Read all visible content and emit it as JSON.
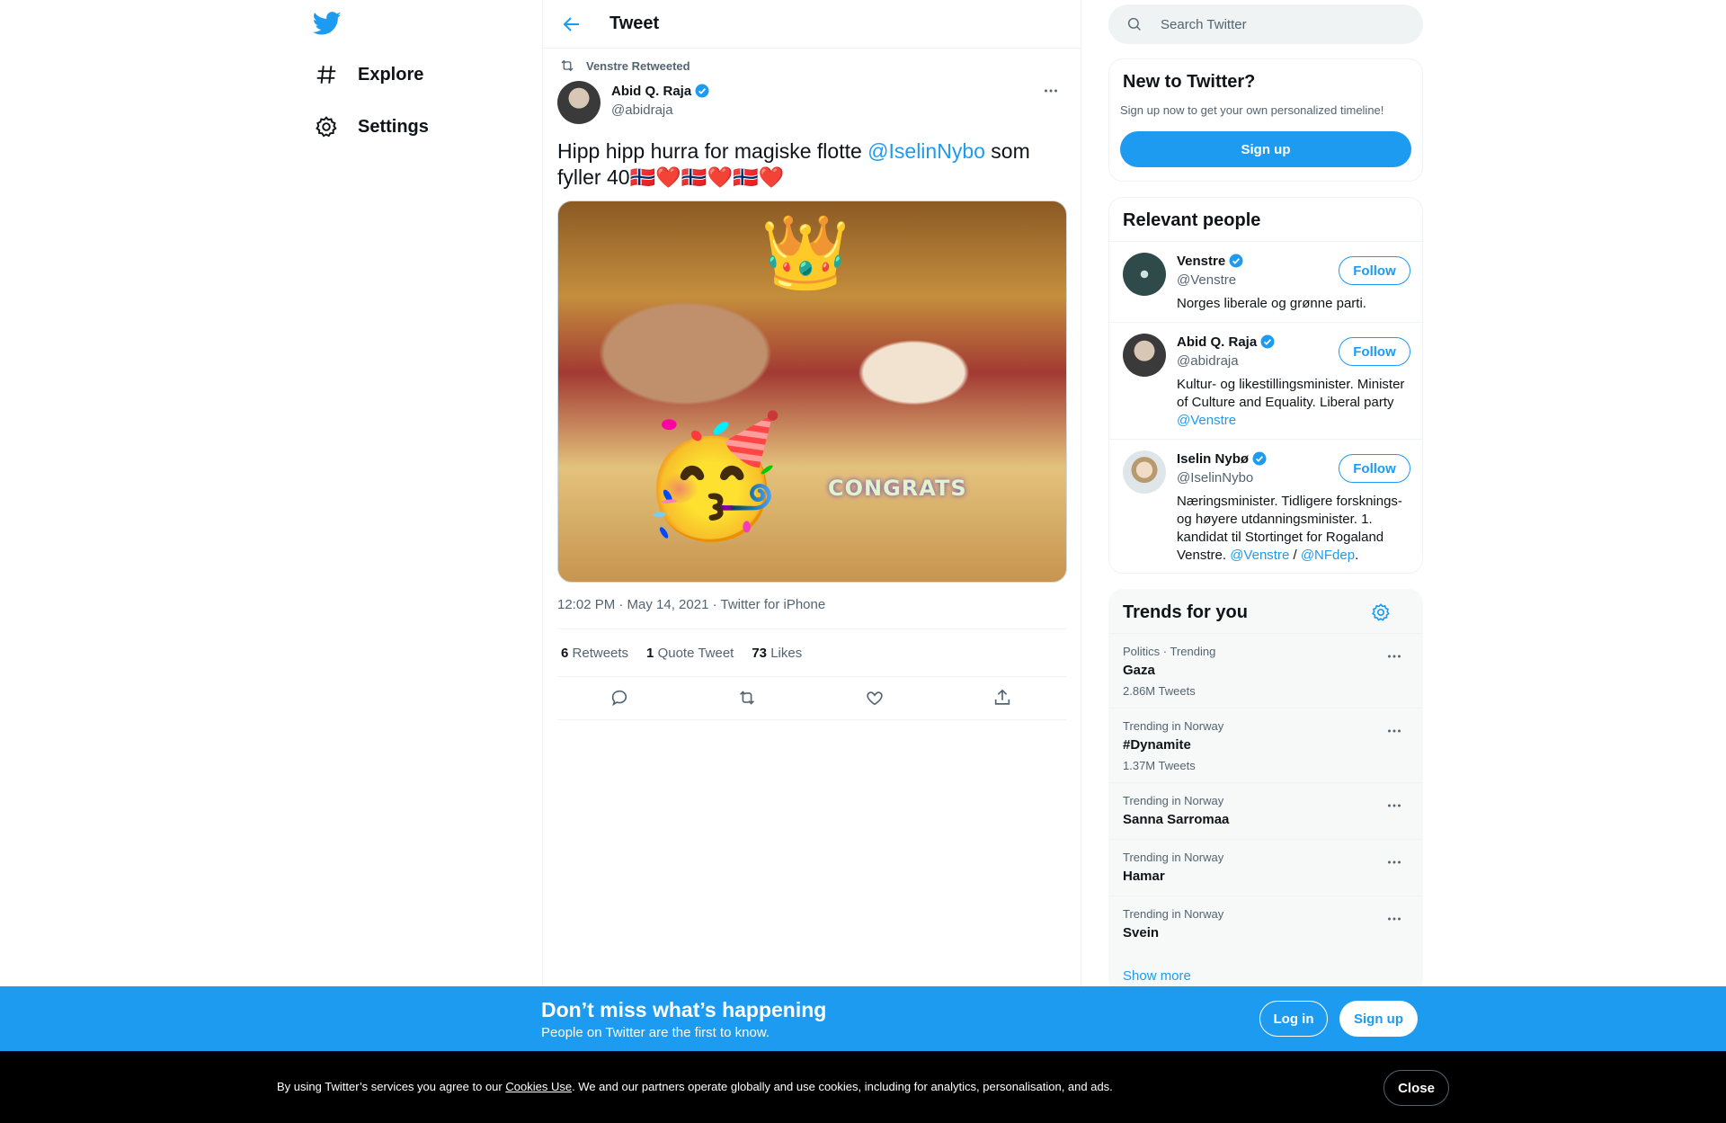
{
  "colors": {
    "accent": "#1d9bf0",
    "text": "#0f1419",
    "muted": "#536471",
    "border": "#eff3f4"
  },
  "nav": {
    "logo": "twitter-bird-icon",
    "items": [
      {
        "label": "Explore",
        "icon": "hashtag-icon"
      },
      {
        "label": "Settings",
        "icon": "gear-icon"
      }
    ]
  },
  "header": {
    "title": "Tweet",
    "back_icon": "arrow-left-icon"
  },
  "tweet": {
    "retweeted_by": "Venstre Retweeted",
    "author_name": "Abid Q. Raja",
    "author_handle": "@abidraja",
    "text_before": "Hipp hipp hurra for magiske flotte ",
    "mention": "@IselinNybo",
    "text_after": " som fyller 40🇳🇴❤️🇳🇴❤️🇳🇴❤️",
    "photo_overlay": "CONGRATS",
    "meta": "12:02 PM · May 14, 2021 · Twitter for iPhone",
    "stats": [
      {
        "count": "6",
        "label": "Retweets"
      },
      {
        "count": "1",
        "label": "Quote Tweet"
      },
      {
        "count": "73",
        "label": "Likes"
      }
    ]
  },
  "search": {
    "placeholder": "Search Twitter"
  },
  "new_to_twitter": {
    "title": "New to Twitter?",
    "subtitle": "Sign up now to get your own personalized timeline!",
    "button": "Sign up"
  },
  "relevant_people": {
    "title": "Relevant people",
    "follow_label": "Follow",
    "people": [
      {
        "name": "Venstre",
        "handle": "@Venstre",
        "bio": "Norges liberale og grønne parti."
      },
      {
        "name": "Abid Q. Raja",
        "handle": "@abidraja",
        "bio": "Kultur- og likestillingsminister. Minister of Culture and Equality. Liberal party ",
        "bio_link": "@Venstre"
      },
      {
        "name": "Iselin Nybø",
        "handle": "@IselinNybo",
        "bio": "Næringsminister. Tidligere forsknings- og høyere utdanningsminister. 1. kandidat til Stortinget for Rogaland Venstre. ",
        "bio_link": "@Venstre",
        "bio_sep": " / ",
        "bio_link2": "@NFdep",
        "bio_end": "."
      }
    ]
  },
  "trends": {
    "title": "Trends for you",
    "items": [
      {
        "context": "Politics · Trending",
        "name": "Gaza",
        "count": "2.86M Tweets"
      },
      {
        "context": "Trending in Norway",
        "name": "#Dynamite",
        "count": "1.37M Tweets"
      },
      {
        "context": "Trending in Norway",
        "name": "Sanna Sarromaa",
        "count": ""
      },
      {
        "context": "Trending in Norway",
        "name": "Hamar",
        "count": ""
      },
      {
        "context": "Trending in Norway",
        "name": "Svein",
        "count": ""
      }
    ],
    "show_more": "Show more"
  },
  "banner": {
    "title": "Don’t miss what’s happening",
    "subtitle": "People on Twitter are the first to know.",
    "login": "Log in",
    "signup": "Sign up"
  },
  "cookies": {
    "text_before": "By using Twitter’s services you agree to our ",
    "link": "Cookies Use",
    "text_after": ". We and our partners operate globally and use cookies, including for analytics, personalisation, and ads.",
    "close": "Close"
  }
}
